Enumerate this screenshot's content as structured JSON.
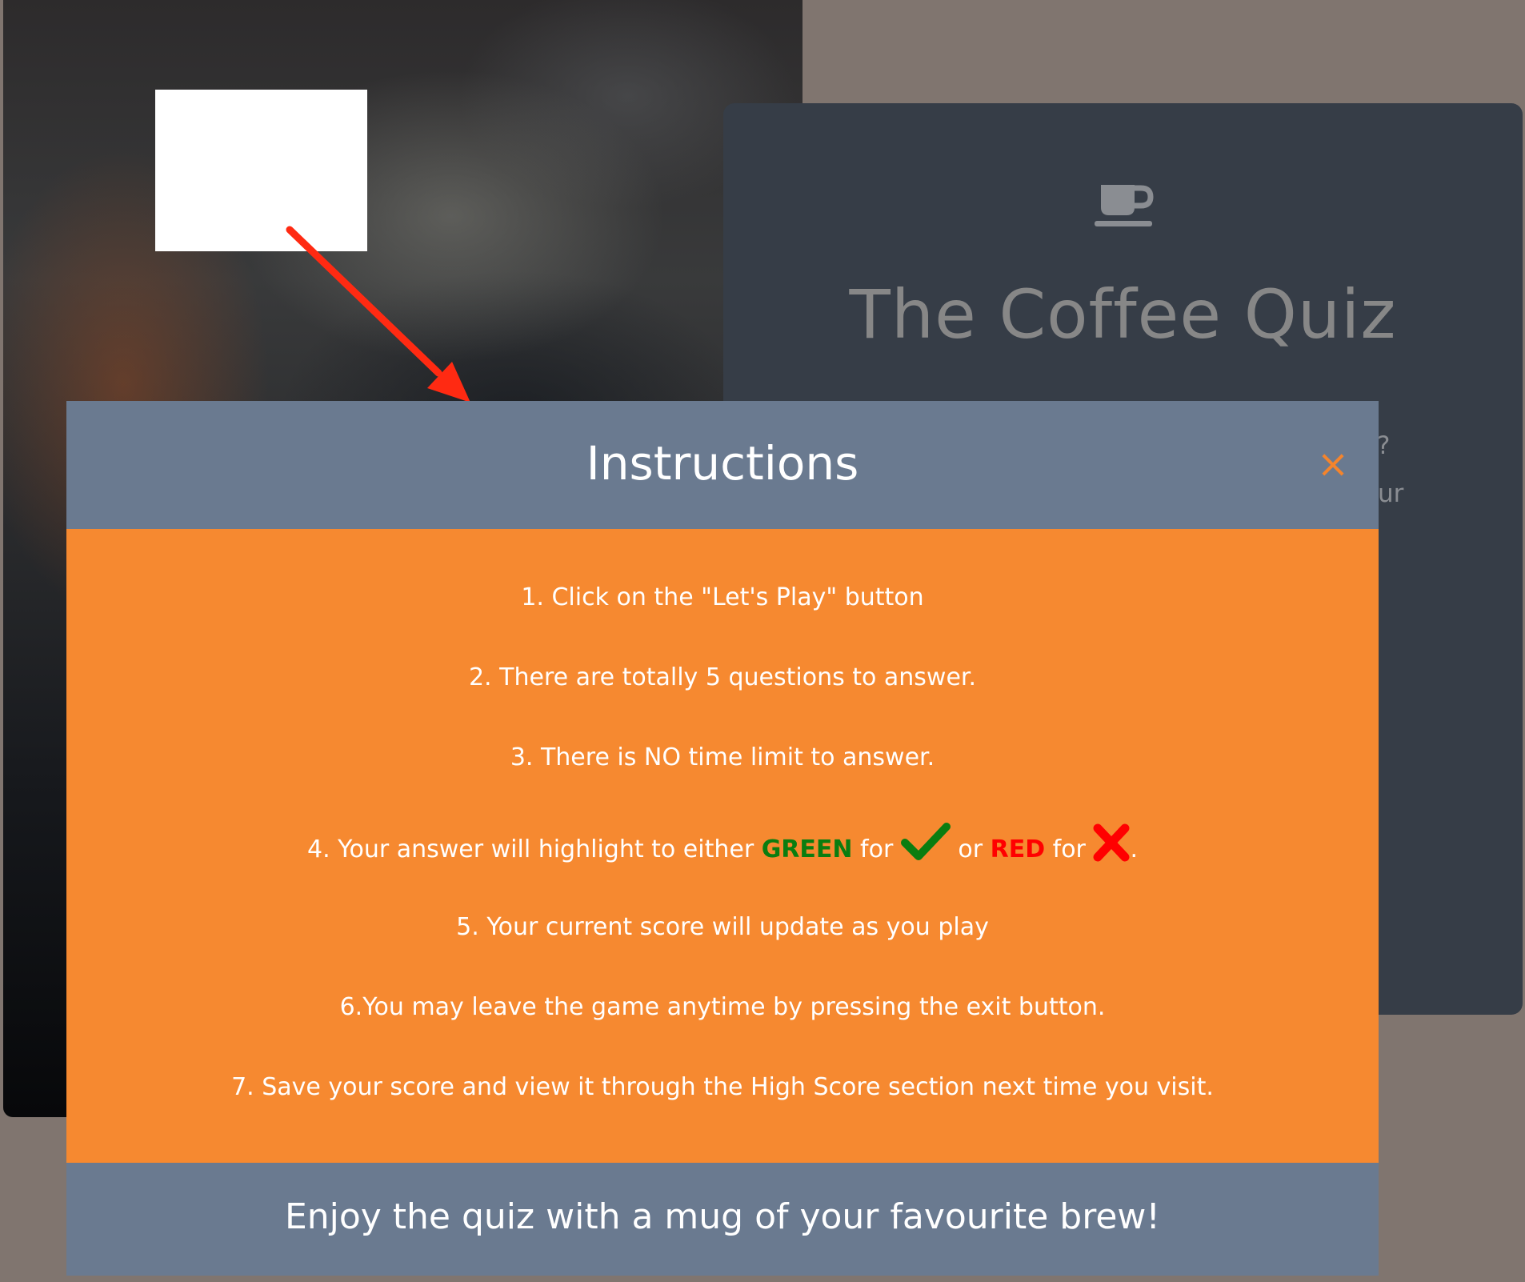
{
  "colors": {
    "page_bg": "#80756f",
    "card_bg": "#363d47",
    "modal_header_bg": "#6a7a90",
    "modal_body_bg": "#f68930",
    "close_icon": "#f4842c",
    "green": "#0a7d10",
    "red": "#ff0000",
    "arrow": "#ff2a12"
  },
  "card": {
    "icon": "coffee-cup-icon",
    "title": "The Coffee Quiz",
    "fragment_1": "?",
    "fragment_2": "ur"
  },
  "modal": {
    "title": "Instructions",
    "close_label": "×",
    "steps": {
      "s1": "1. Click on the \"Let's Play\" button",
      "s2": "2. There are totally 5 questions to answer.",
      "s3": "3. There is NO time limit to answer.",
      "s4": {
        "prefix": "4. Your answer will highlight to either ",
        "green": "GREEN",
        "for_1": " for ",
        "or": " or ",
        "red": "RED",
        "for_2": " for ",
        "end": ".",
        "green_icon": "checkmark-icon",
        "red_icon": "cross-icon"
      },
      "s5": "5. Your current score will update as you play",
      "s6": "6.You may leave the game anytime by pressing the exit button.",
      "s7": "7. Save your score and view it through the High Score section next time you visit."
    },
    "footer": "Enjoy the quiz with a mug of your favourite brew!"
  }
}
